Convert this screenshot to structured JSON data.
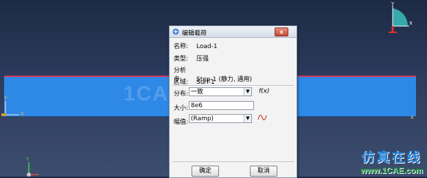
{
  "dialog": {
    "title": "编辑载荷",
    "close_label": "x",
    "info": [
      {
        "label": "名称:",
        "value": "Load-1"
      },
      {
        "label": "类型:",
        "value": "压强"
      },
      {
        "label": "分析步:",
        "value": "Step-1 (静力, 通用)"
      },
      {
        "label": "区域:",
        "value": "Surf-1"
      }
    ],
    "distribution_label": "分布:",
    "distribution_value": "一致",
    "fx_label": "f(x)",
    "magnitude_label": "大小:",
    "magnitude_value": "8e6",
    "amplitude_label": "幅值:",
    "amplitude_value": "(Ramp)",
    "ok_label": "确定",
    "cancel_label": "取消"
  },
  "viewport": {
    "center_watermark": "1CAE.COM",
    "brand_cn": "仿真在线",
    "brand_url": "www.1CAE.com",
    "triad_top_y": "Y",
    "triad_top_x": "X",
    "triad_bottom_y": "Y",
    "part_left_y": "Y",
    "part_left_x": "X",
    "part_colour": "#2e88e6",
    "edge_colour": "#d63a5a"
  }
}
